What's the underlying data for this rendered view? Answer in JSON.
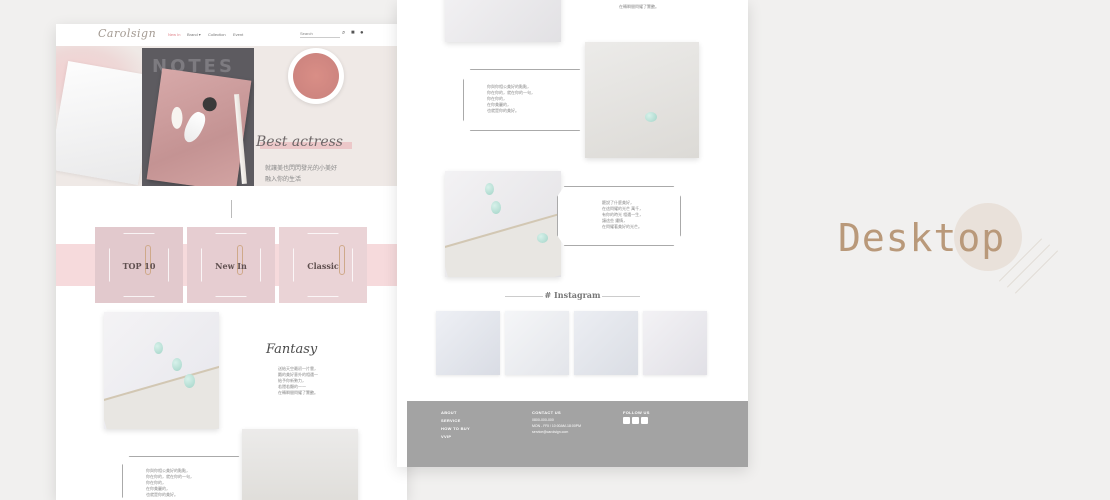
{
  "label": "Desktop",
  "site": {
    "logo": "Carolsign",
    "nav": [
      "New In",
      "Brand ▾",
      "Collection",
      "Event"
    ],
    "search_placeholder": "Search"
  },
  "hero": {
    "script_title": "Best actress",
    "tagline_1": "就讓美也閃閃發光的小美好",
    "tagline_2": "融入你的生活",
    "notebook_text": "NOTES"
  },
  "categories": [
    "TOP 10",
    "New In",
    "Classic"
  ],
  "fantasy": {
    "script_title": "Fantasy",
    "lines": [
      "送給天空最初一片雲，",
      "飄的美好意外的相遇一",
      "給予你新勢力，",
      "若隱若顯的一一",
      "在轉瞬間閃耀了驚艷。"
    ]
  },
  "blocks": {
    "poem_a": [
      "你與你相公美好的點點，",
      "你在你的，就在你的一句，",
      "你在你的，",
      "在你美麗的，",
      "也就是你的美好。"
    ],
    "poem_b": [
      "聽說了什麼美好，",
      "在這閃耀的光芒 萬千，",
      "有你的時光 相遇一生，",
      "讓這些 鍾情，",
      "在閃耀著美好的光芒。"
    ],
    "top_right_lines": [
      "在轉瞬間閃耀了驚艷。"
    ]
  },
  "instagram": {
    "title": "# Instagram"
  },
  "footer": {
    "col1": [
      "ABOUT",
      "SERVICE",
      "HOW TO BUY",
      "VVIP"
    ],
    "contact_title": "CONTACT US",
    "contact_phone": "0800-000-000",
    "contact_hours": "MON - FRI / 10:00AM-18:00PM",
    "contact_email": "service@carolsign.com",
    "follow_title": "FOLLOW US"
  },
  "colors": {
    "brand": "#b9997a",
    "accent_pink": "#e0838a",
    "footer": "#a3a3a3"
  }
}
